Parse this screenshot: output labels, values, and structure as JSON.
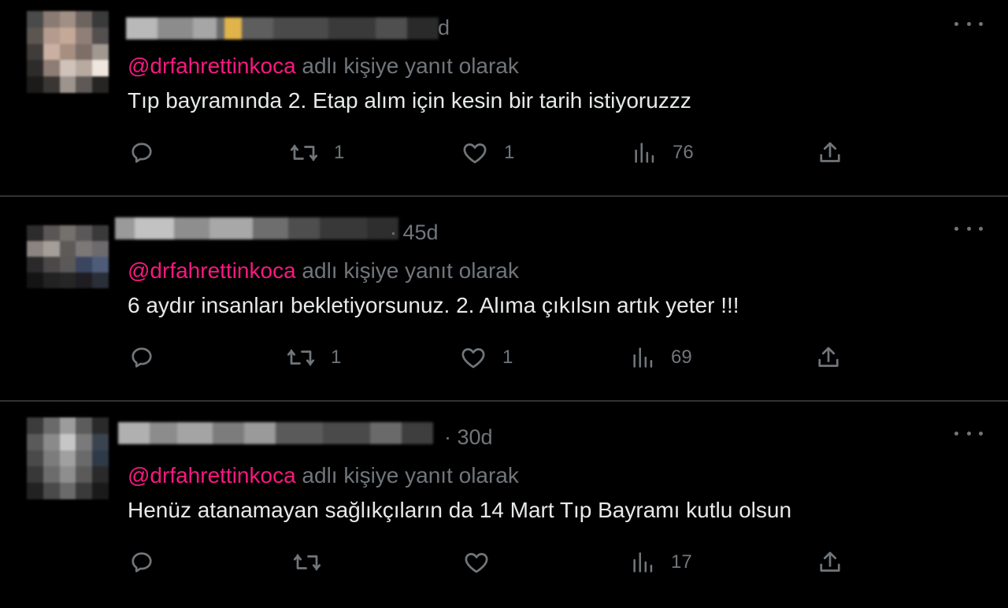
{
  "colors": {
    "background": "#000000",
    "text_primary": "#e7e9ea",
    "text_secondary": "#71767b",
    "mention": "#f91880",
    "divider": "#2f3336"
  },
  "icons": {
    "reply": "reply-icon",
    "retweet": "retweet-icon",
    "like": "heart-icon",
    "views": "views-icon",
    "share": "share-icon",
    "more": "more-icon"
  },
  "tweets": [
    {
      "time": "d",
      "reply_handle": "@drfahrettinkoca",
      "reply_text": "adlı kişiye yanıt olarak",
      "text": "Tıp bayramında 2. Etap alım için kesin bir tarih istiyoruzzz",
      "retweets": "1",
      "likes": "1",
      "views": "76"
    },
    {
      "time": "· 45d",
      "reply_handle": "@drfahrettinkoca",
      "reply_text": "adlı kişiye yanıt olarak",
      "text": "6 aydır insanları bekletiyorsunuz. 2. Alıma çıkılsın artık yeter !!!",
      "retweets": "1",
      "likes": "1",
      "views": "69"
    },
    {
      "time": "· 30d",
      "reply_handle": "@drfahrettinkoca",
      "reply_text": "adlı kişiye yanıt olarak",
      "text": "Henüz atanamayan sağlıkçıların da 14 Mart Tıp Bayramı kutlu olsun",
      "retweets": "",
      "likes": "",
      "views": "17"
    }
  ]
}
